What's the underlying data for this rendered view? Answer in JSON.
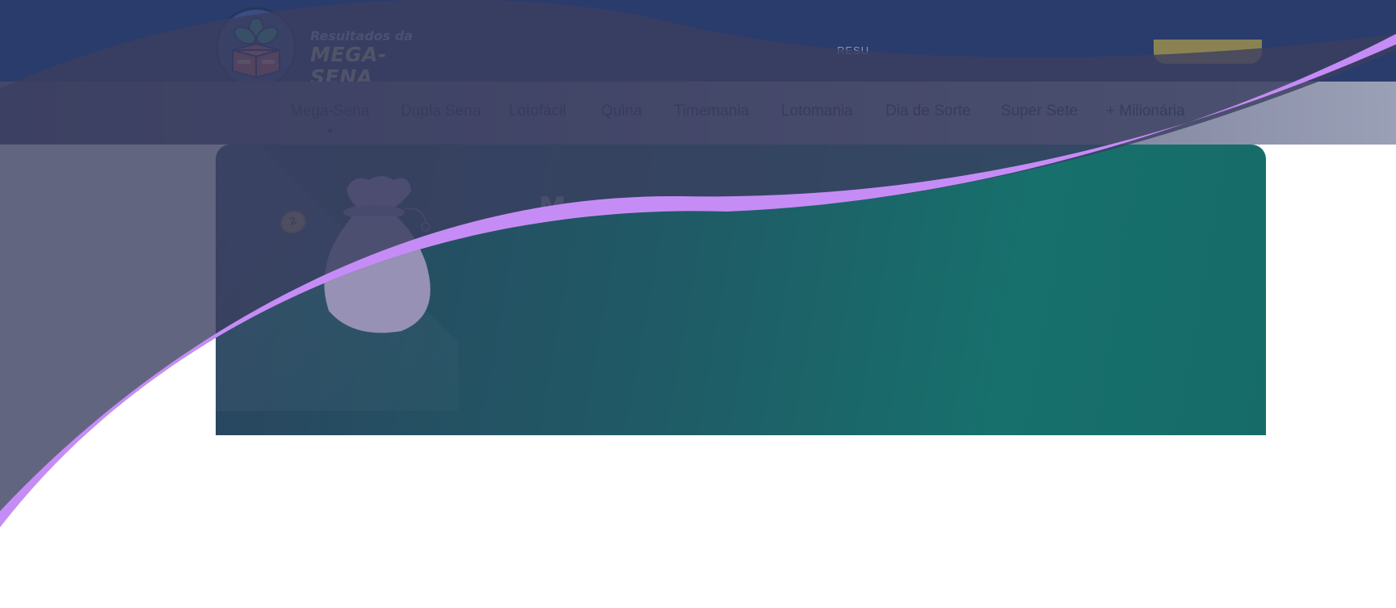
{
  "header": {
    "logo": {
      "line1": "Resultados da",
      "line2": "MEGA-SENA"
    },
    "top_link_label": "RESU",
    "cta_button_label": ""
  },
  "nav": {
    "items": [
      {
        "label": "Mega-Sena",
        "active": true
      },
      {
        "label": "Dupla Sena",
        "active": false
      },
      {
        "label": "Lotofácil",
        "active": false
      },
      {
        "label": "Quina",
        "active": false
      },
      {
        "label": "Timemania",
        "active": false
      },
      {
        "label": "Lotomania",
        "active": false
      },
      {
        "label": "Dia de Sorte",
        "active": false
      },
      {
        "label": "Super Sete",
        "active": false
      },
      {
        "label": "+ Milionária",
        "active": false
      }
    ]
  },
  "hero": {
    "coin_label": "2",
    "title_partial": "M"
  },
  "colors": {
    "topbar": "#2a3c6b",
    "overlay_dark": "#3b3e60",
    "wave_accent": "#c68cf6",
    "hero_teal": "#17706c",
    "button_gold": "#8a8252"
  },
  "icons": {
    "logo": "lottery-box-clover-icon",
    "hero_illustration": "money-bag-icon",
    "coin": "coin-icon"
  }
}
